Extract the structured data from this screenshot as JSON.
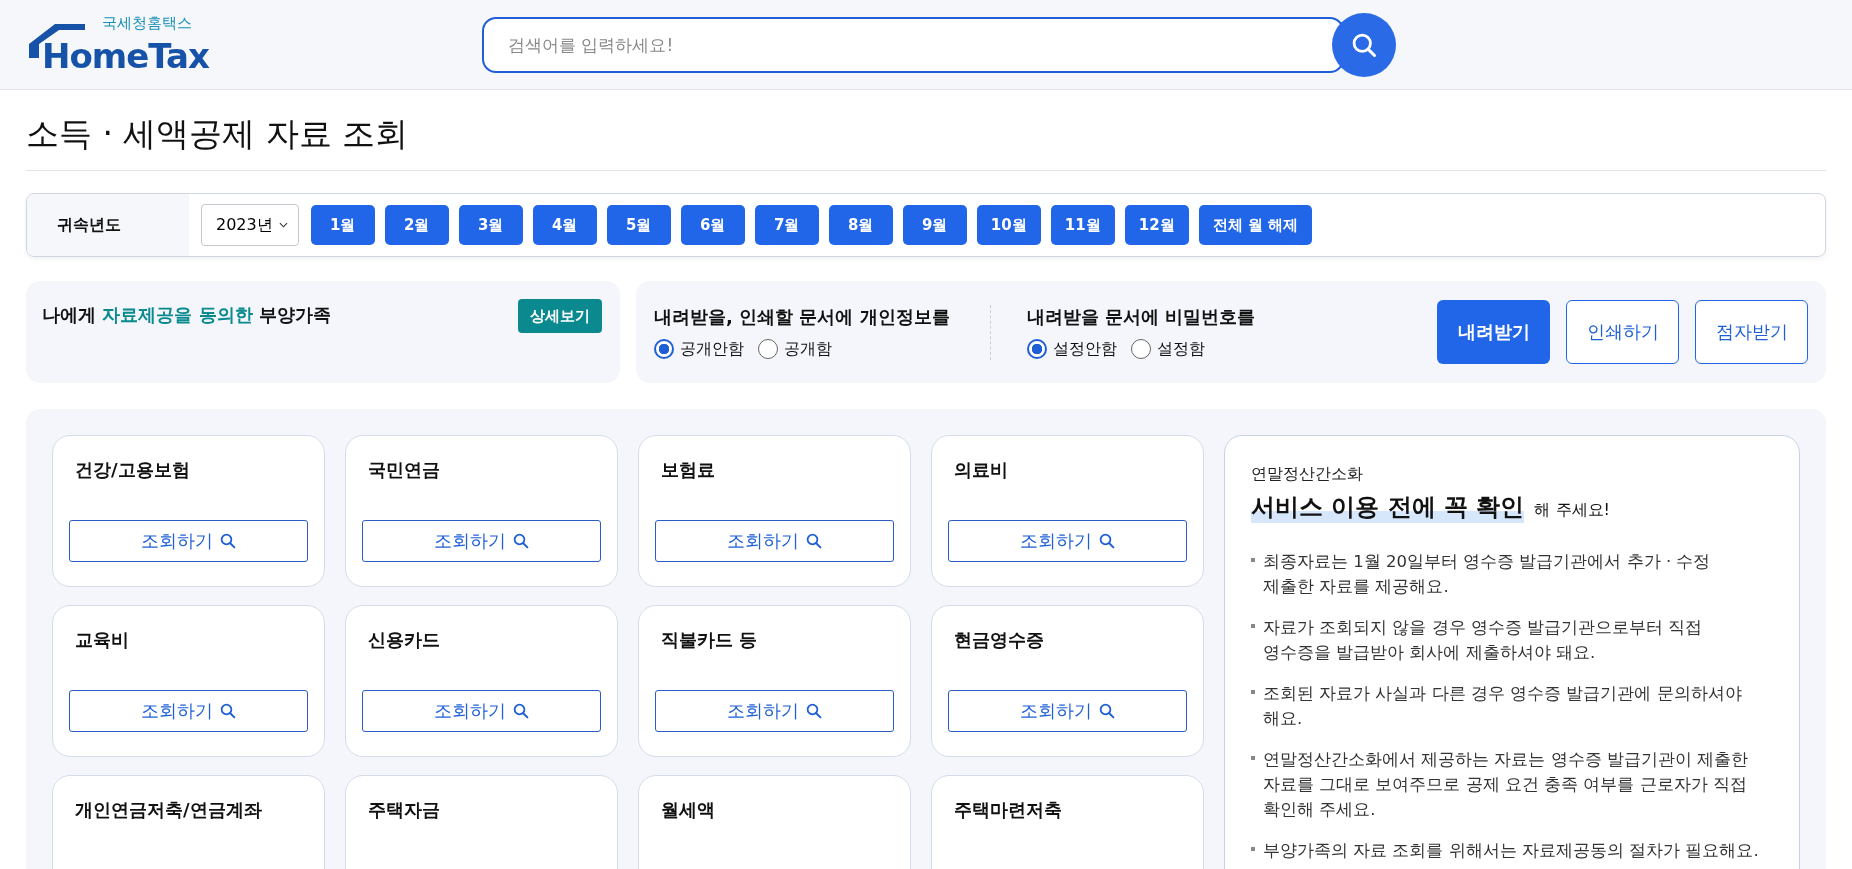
{
  "header": {
    "logo_sub": "국세청홈택스",
    "logo_main": "HomeTax",
    "search": {
      "placeholder": "검색어를 입력하세요!"
    }
  },
  "page_title": "소득 · 세액공제 자료 조회",
  "year_filter": {
    "label": "귀속년도",
    "year": "2023년",
    "months": [
      {
        "label": "1월"
      },
      {
        "label": "2월"
      },
      {
        "label": "3월"
      },
      {
        "label": "4월"
      },
      {
        "label": "5월"
      },
      {
        "label": "6월"
      },
      {
        "label": "7월"
      },
      {
        "label": "8월"
      },
      {
        "label": "9월"
      },
      {
        "label": "10월"
      },
      {
        "label": "11월"
      },
      {
        "label": "12월"
      },
      {
        "label": "전체 월 해제"
      }
    ]
  },
  "dependents": {
    "text": "나에게 **자료제공을 동의한** 부양가족",
    "button": "상세보기"
  },
  "options": [
    {
      "label": "내려받을, 인쇄할 문서에 개인정보를",
      "choices": [
        {
          "label": "공개안함",
          "selected": true
        },
        {
          "label": "공개함",
          "selected": false
        }
      ]
    },
    {
      "label": "내려받을 문서에 비밀번호를",
      "choices": [
        {
          "label": "설정안함",
          "selected": true
        },
        {
          "label": "설정함",
          "selected": false
        }
      ]
    }
  ],
  "actions": [
    {
      "label": "내려받기",
      "primary": true
    },
    {
      "label": "인쇄하기",
      "primary": false
    },
    {
      "label": "점자받기",
      "primary": false
    }
  ],
  "categories": [
    {
      "title": "건강/고용보험",
      "button": "조회하기"
    },
    {
      "title": "국민연금",
      "button": "조회하기"
    },
    {
      "title": "보험료",
      "button": "조회하기"
    },
    {
      "title": "의료비",
      "button": "조회하기"
    },
    {
      "title": "교육비",
      "button": "조회하기"
    },
    {
      "title": "신용카드",
      "button": "조회하기"
    },
    {
      "title": "직불카드 등",
      "button": "조회하기"
    },
    {
      "title": "현금영수증",
      "button": "조회하기"
    },
    {
      "title": "개인연금저축/연금계좌"
    },
    {
      "title": "주택자금"
    },
    {
      "title": "월세액"
    },
    {
      "title": "주택마련저축"
    }
  ],
  "notice": {
    "eyebrow": "연말정산간소화",
    "title_highlight": "서비스 이용 전에 꼭 확인",
    "title_rest": "해 주세요!",
    "items": [
      "최종자료는 1월 20일부터 영수증 발급기관에서 추가 · 수정 제출한 자료를 제공해요.",
      "자료가 조회되지 않을 경우 영수증 발급기관으로부터 직접 영수증을 발급받아 회사에 제출하셔야 돼요.",
      "조회된 자료가 사실과 다른 경우 영수증 발급기관에 문의하셔야 해요.",
      "연말정산간소화에서 제공하는 자료는 영수증 발급기관이 제출한 자료를 그대로 보여주므로 공제 요건 충족 여부를 근로자가 직접 확인해 주세요.",
      "부양가족의 자료 조회를 위해서는 자료제공동의 절차가 필요해요."
    ]
  }
}
